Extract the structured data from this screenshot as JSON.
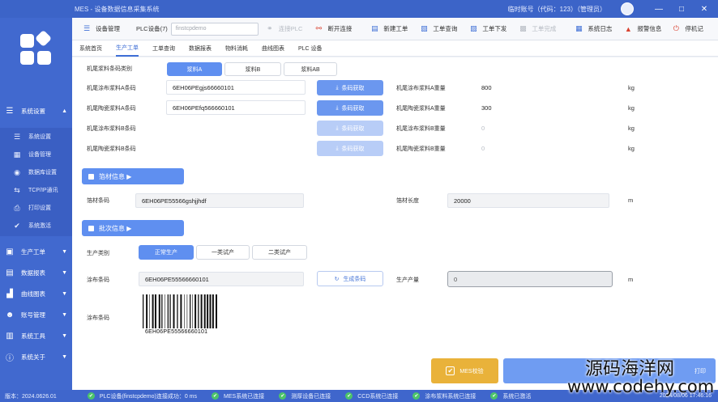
{
  "window": {
    "title": "MES - 设备数据信息采集系统",
    "user_info": "临时账号（代码：123）（管理员）",
    "minimize_label": "—",
    "restore_label": "□",
    "close_label": "✕"
  },
  "sidebar": {
    "group_settings": "系统设置",
    "sub_items": [
      {
        "label": "系统设置",
        "icon": "list-icon"
      },
      {
        "label": "设备管理",
        "icon": "grid-icon"
      },
      {
        "label": "数据库设置",
        "icon": "database-icon"
      },
      {
        "label": "TCP/IP通讯",
        "icon": "network-icon"
      },
      {
        "label": "打印设置",
        "icon": "printer-icon"
      },
      {
        "label": "系统激活",
        "icon": "shield-check-icon"
      }
    ],
    "groups": [
      {
        "label": "生产工单",
        "icon": "briefcase-icon"
      },
      {
        "label": "数据报表",
        "icon": "report-icon"
      },
      {
        "label": "曲线图表",
        "icon": "chart-icon"
      },
      {
        "label": "账号管理",
        "icon": "users-icon"
      },
      {
        "label": "系统工具",
        "icon": "toolbox-icon"
      },
      {
        "label": "系统关于",
        "icon": "info-icon"
      }
    ],
    "version": "版本：2024.0626.01"
  },
  "toolbar": {
    "device_mgmt": "设备管理",
    "plc_device": "PLC设备(7)",
    "plc_select_value": "finstcpdemo",
    "connect_plc": "连接PLC",
    "disconnect": "断开连接",
    "new_order": "新建工单",
    "order_query": "工单查询",
    "order_issue": "工单下发",
    "order_complete": "工单完成",
    "system_log": "系统日志",
    "alarm_info": "报警信息",
    "stop_record": "停机记"
  },
  "tabs": [
    "系统首页",
    "生产工单",
    "工单查询",
    "数据报表",
    "物料消耗",
    "曲线图表",
    "PLC 设备"
  ],
  "tab_active": 1,
  "form": {
    "slurry_type_label": "机尾浆料条码类别",
    "slurry_options": [
      "浆料A",
      "浆料B",
      "浆料AB"
    ],
    "rows": [
      {
        "label": "机尾涂布浆料A条码",
        "value": "6EH06PEgjs66660101",
        "button": "条码获取",
        "weight_label": "机尾涂布浆料A重量",
        "weight": "800",
        "unit": "kg"
      },
      {
        "label": "机尾陶瓷浆料A条码",
        "value": "6EH06PEfq566660101",
        "button": "条码获取",
        "weight_label": "机尾陶瓷浆料A重量",
        "weight": "300",
        "unit": "kg"
      },
      {
        "label": "机尾涂布浆料B条码",
        "value": "",
        "button": "条码获取",
        "weight_label": "机尾涂布浆料B重量",
        "weight": "0",
        "unit": "kg"
      },
      {
        "label": "机尾陶瓷浆料B条码",
        "value": "",
        "button": "条码获取",
        "weight_label": "机尾陶瓷浆料B重量",
        "weight": "0",
        "unit": "kg"
      }
    ],
    "foil_section": "箔材信息 ▶",
    "foil_code_label": "箔材条码",
    "foil_code": "6EH06PE55566gshjjhdf",
    "foil_length_label": "箔材长度",
    "foil_length": "20000",
    "foil_length_unit": "m",
    "batch_section": "批次信息 ▶",
    "production_type_label": "生产类别",
    "production_options": [
      "正常生产",
      "一类试产",
      "二类试产"
    ],
    "coating_code_label": "涂布条码",
    "coating_code": "6EH06PE55566660101",
    "generate_button": "生成条码",
    "output_label": "生产产量",
    "output_value": "0",
    "output_unit": "m",
    "coating_barcode_label": "涂布条码",
    "barcode_text": "6EH06PE55566660101",
    "mes_button": "MES校验",
    "print_button": "打印"
  },
  "statusbar": {
    "items": [
      "PLC设备(finstcpdemo)连接成功：0 ms",
      "MES系统已连接",
      "测厚设备已连接",
      "CCD系统已连接",
      "涂布浆料系统已连接",
      "系统已激活"
    ],
    "datetime": "2024/08/06 17:46:16"
  },
  "watermark": {
    "line1": "源码海洋网",
    "line2": "www.codehy.com"
  },
  "colors": {
    "primary": "#4169cf",
    "accent": "#5f8ff0",
    "warning": "#e9b23a",
    "success": "#4cc46a"
  }
}
